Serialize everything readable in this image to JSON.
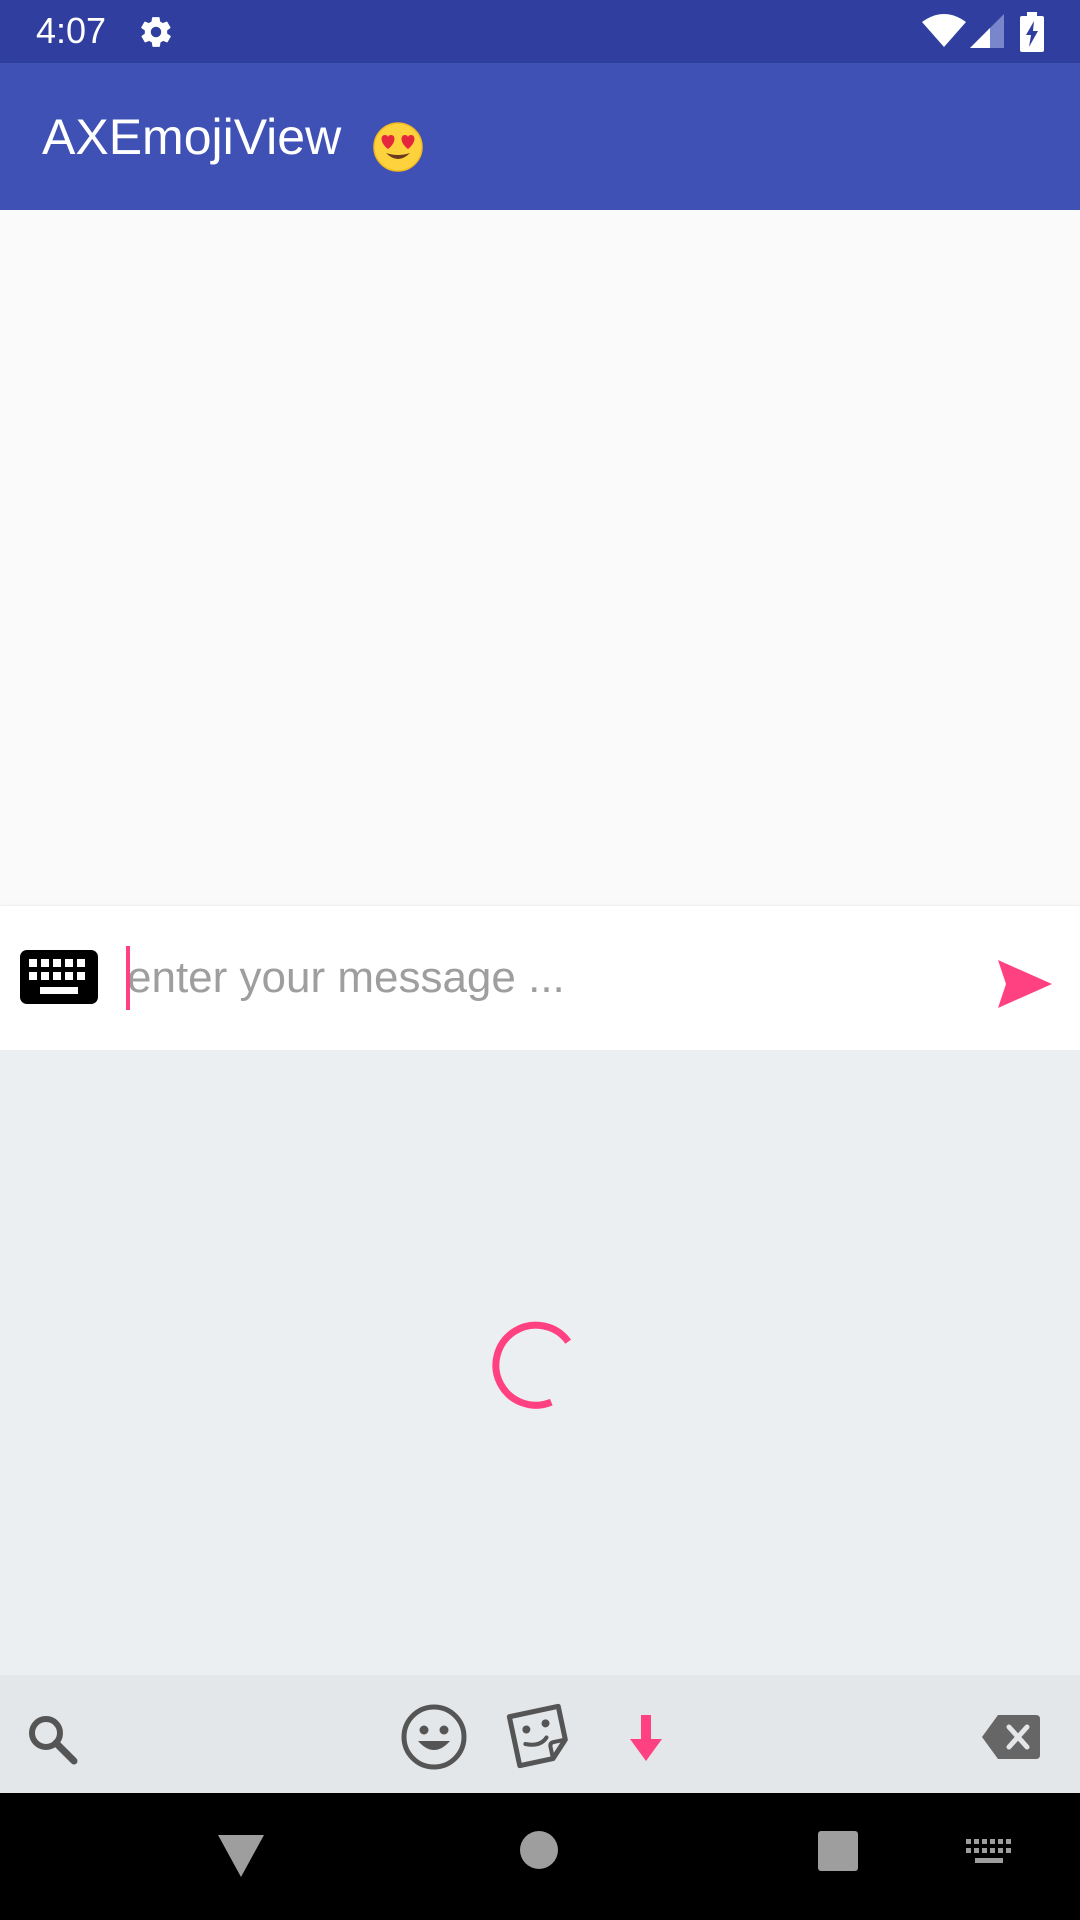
{
  "status_bar": {
    "time": "4:07",
    "icons": [
      "settings-gear-icon",
      "wifi-icon",
      "cell-signal-icon",
      "battery-charging-icon"
    ]
  },
  "app_bar": {
    "title": "AXEmojiView",
    "title_emoji_icon": "heart-eyes-emoji-icon"
  },
  "message_bar": {
    "keyboard_toggle_icon": "keyboard-icon",
    "input_value": "",
    "placeholder": "enter your message ...",
    "send_icon": "send-icon"
  },
  "emoji_panel": {
    "state": "loading",
    "spinner_icon": "loading-spinner-icon",
    "tabs": [
      {
        "icon": "search-icon",
        "selected": false
      },
      {
        "icon": "smiley-face-icon",
        "selected": false
      },
      {
        "icon": "sticker-icon",
        "selected": false
      },
      {
        "icon": "download-arrow-icon",
        "selected": true
      },
      {
        "icon": "backspace-icon",
        "selected": false
      }
    ]
  },
  "nav_bar": {
    "icons": [
      "back-triangle-icon",
      "home-circle-icon",
      "recents-square-icon",
      "keyboard-switch-icon"
    ]
  },
  "colors": {
    "status_bar": "#303f9f",
    "app_bar": "#3f51b5",
    "accent": "#ff4081",
    "panel_background": "#eceff1",
    "tab_bar_background": "#e4e7e9"
  }
}
